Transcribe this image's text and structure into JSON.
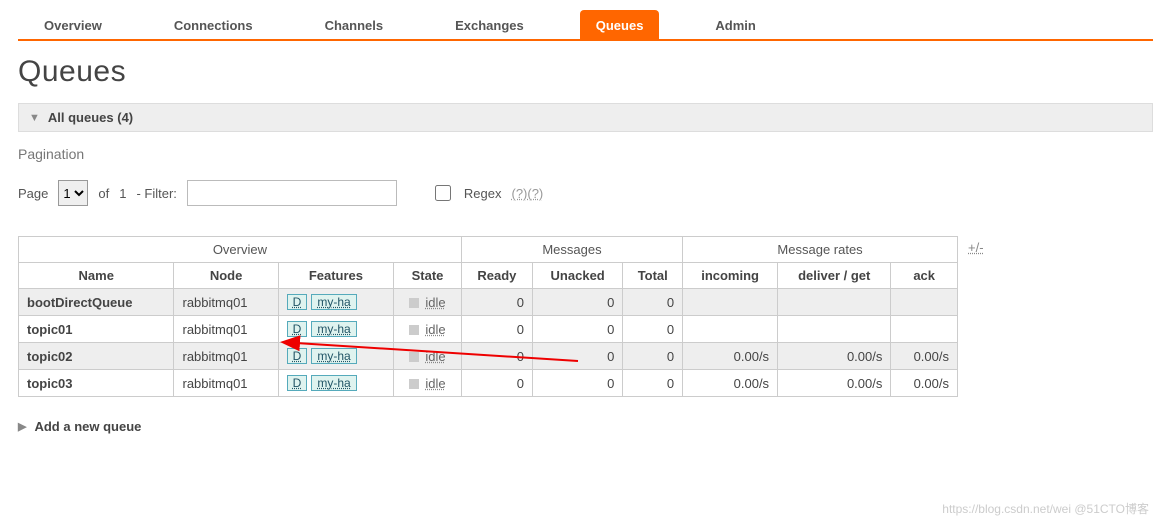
{
  "tabs": {
    "overview": "Overview",
    "connections": "Connections",
    "channels": "Channels",
    "exchanges": "Exchanges",
    "queues": "Queues",
    "admin": "Admin"
  },
  "page_title": "Queues",
  "section_all_queues": "All queues (4)",
  "pagination_label": "Pagination",
  "pager": {
    "page_label": "Page",
    "page_value": "1",
    "of_label": "of",
    "total_pages": "1",
    "filter_label": "- Filter:",
    "filter_value": "",
    "regex_label": "Regex",
    "help1": "(?)",
    "help2": "(?)"
  },
  "plus_minus": "+/-",
  "table": {
    "group_headers": {
      "overview": "Overview",
      "messages": "Messages",
      "rates": "Message rates"
    },
    "cols": {
      "name": "Name",
      "node": "Node",
      "features": "Features",
      "state": "State",
      "ready": "Ready",
      "unacked": "Unacked",
      "total": "Total",
      "incoming": "incoming",
      "deliver_get": "deliver / get",
      "ack": "ack"
    },
    "feature_d": "D",
    "feature_ha": "my-ha",
    "state_idle": "idle",
    "rows": [
      {
        "name": "bootDirectQueue",
        "node": "rabbitmq01",
        "ready": "0",
        "unacked": "0",
        "total": "0",
        "incoming": "",
        "deliver_get": "",
        "ack": "",
        "alt": true
      },
      {
        "name": "topic01",
        "node": "rabbitmq01",
        "ready": "0",
        "unacked": "0",
        "total": "0",
        "incoming": "",
        "deliver_get": "",
        "ack": "",
        "alt": false
      },
      {
        "name": "topic02",
        "node": "rabbitmq01",
        "ready": "0",
        "unacked": "0",
        "total": "0",
        "incoming": "0.00/s",
        "deliver_get": "0.00/s",
        "ack": "0.00/s",
        "alt": true
      },
      {
        "name": "topic03",
        "node": "rabbitmq01",
        "ready": "0",
        "unacked": "0",
        "total": "0",
        "incoming": "0.00/s",
        "deliver_get": "0.00/s",
        "ack": "0.00/s",
        "alt": false
      }
    ]
  },
  "add_queue_label": "Add a new queue",
  "watermark": "https://blog.csdn.net/wei    @51CTO博客"
}
